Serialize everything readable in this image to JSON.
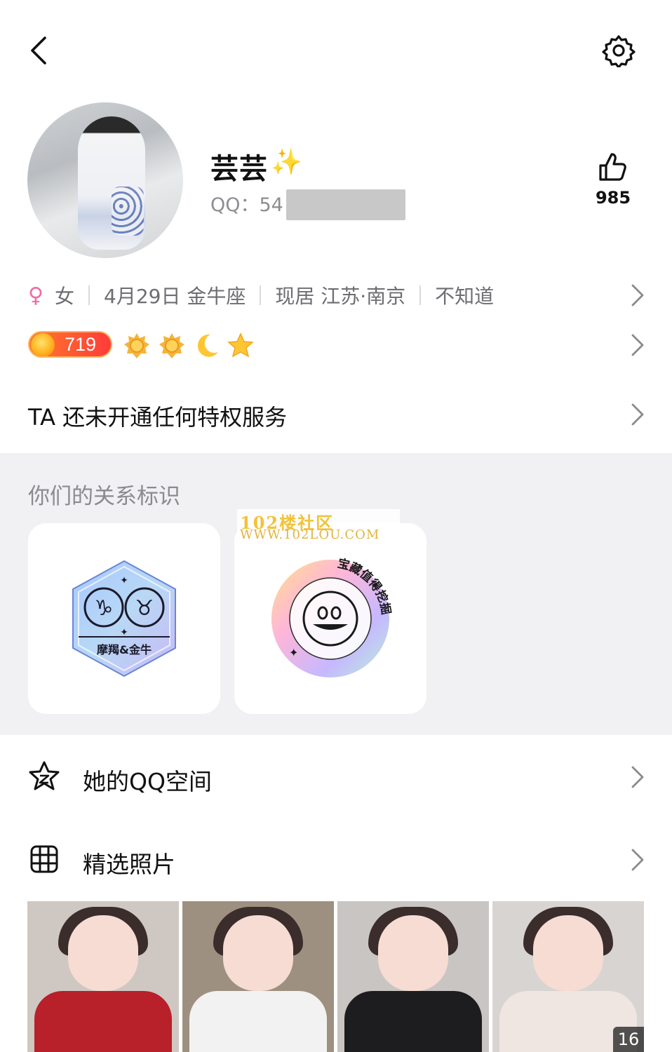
{
  "profile": {
    "nickname": "芸芸",
    "sparkle": "✨",
    "qq_prefix": "QQ：54",
    "likes": "985"
  },
  "info": {
    "gender": "女",
    "birthday": "4月29日 金牛座",
    "location": "现居 江苏·南京",
    "extra": "不知道"
  },
  "level": {
    "value": "719"
  },
  "privilege": {
    "text": "TA 还未开通任何特权服务"
  },
  "relationship": {
    "title": "你们的关系标识",
    "badge1_label": "摩羯&金牛",
    "badge2_text": "宝藏值得挖掘"
  },
  "watermark": {
    "line1": "102楼社区",
    "line2": "WWW.102LOU.COM"
  },
  "menu": {
    "qzone_label": "她的QQ空间",
    "photos_label": "精选照片"
  },
  "photos": {
    "count": "16"
  },
  "colors": {
    "gender_female": "#f06aa7",
    "level_badge": "#ff4a2f",
    "section_bg": "#f1f1f4"
  }
}
